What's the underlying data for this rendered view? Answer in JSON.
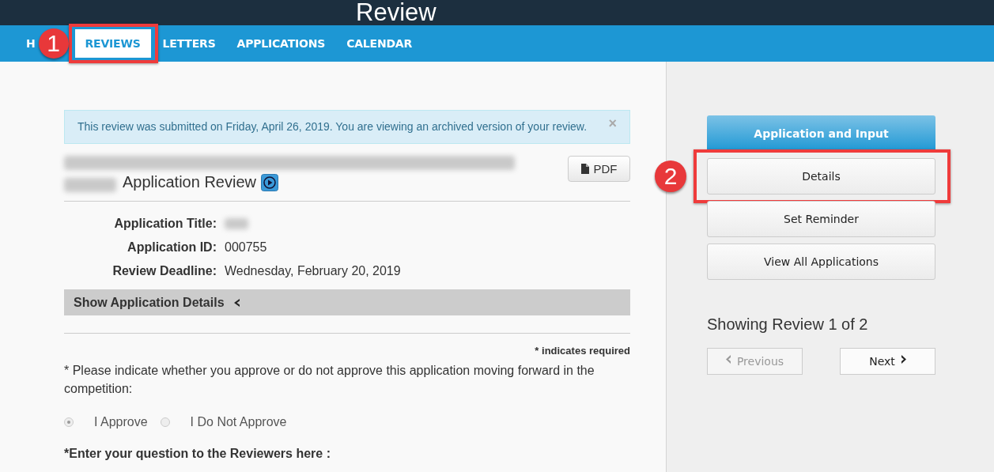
{
  "header": {
    "title": "Review"
  },
  "nav": {
    "items": [
      {
        "label": "H",
        "selected": false
      },
      {
        "label": "REVIEWS",
        "selected": true,
        "callout": "1"
      },
      {
        "label": "LETTERS",
        "selected": false
      },
      {
        "label": "APPLICATIONS",
        "selected": false
      },
      {
        "label": "CALENDAR",
        "selected": false
      }
    ]
  },
  "alert": {
    "message": "This review was submitted on Friday, April 26, 2019. You are viewing an archived version of your review.",
    "close": "×"
  },
  "review": {
    "title": {
      "blurred_prefix": true,
      "text": "Application Review"
    },
    "pdf_button": "PDF",
    "fields": [
      {
        "label": "Application Title:",
        "kind": "blurred"
      },
      {
        "label": "Application ID:",
        "kind": "text",
        "value": "000755"
      },
      {
        "label": "Review Deadline:",
        "kind": "text",
        "value": "Wednesday, February 20, 2019"
      }
    ],
    "details_toggle": {
      "label": "Show Application Details",
      "expanded": false
    },
    "required_note": "* indicates required",
    "question": {
      "prompt": "* Please indicate whether you approve or do not approve this application moving forward in the competition:",
      "disabled": true,
      "options": [
        {
          "label": "I Approve",
          "selected": true
        },
        {
          "label": "I Do Not Approve",
          "selected": false
        }
      ]
    },
    "next_prompt": "*Enter your question to the Reviewers here :"
  },
  "sidebar": {
    "heading": "Application and Input",
    "buttons": [
      {
        "label": "Details",
        "callout": "2"
      },
      {
        "label": "Set Reminder"
      },
      {
        "label": "View All Applications"
      }
    ],
    "pager_text": "Showing Review 1 of 2",
    "previous": {
      "label": "Previous",
      "disabled": true
    },
    "next": {
      "label": "Next",
      "disabled": false
    }
  }
}
